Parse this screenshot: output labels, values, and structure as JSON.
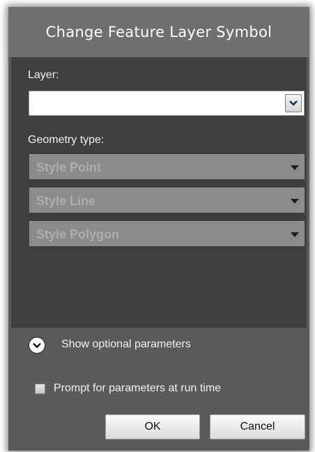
{
  "dialog": {
    "title": "Change Feature Layer Symbol"
  },
  "layer": {
    "label": "Layer:",
    "value": ""
  },
  "geometry": {
    "label": "Geometry type:",
    "options": [
      "Style Point",
      "Style Line",
      "Style Polygon"
    ]
  },
  "optional": {
    "label": "Show optional parameters"
  },
  "prompt": {
    "label": "Prompt for parameters at run time",
    "checked": false
  },
  "buttons": {
    "ok": "OK",
    "cancel": "Cancel"
  },
  "colors": {
    "title_bg": "#6f6f6f",
    "body_bg": "#3f3f3f",
    "footer_bg": "#5a5a5a",
    "disabled_select_bg": "#8b8b8b",
    "disabled_text": "#aeaeae"
  }
}
